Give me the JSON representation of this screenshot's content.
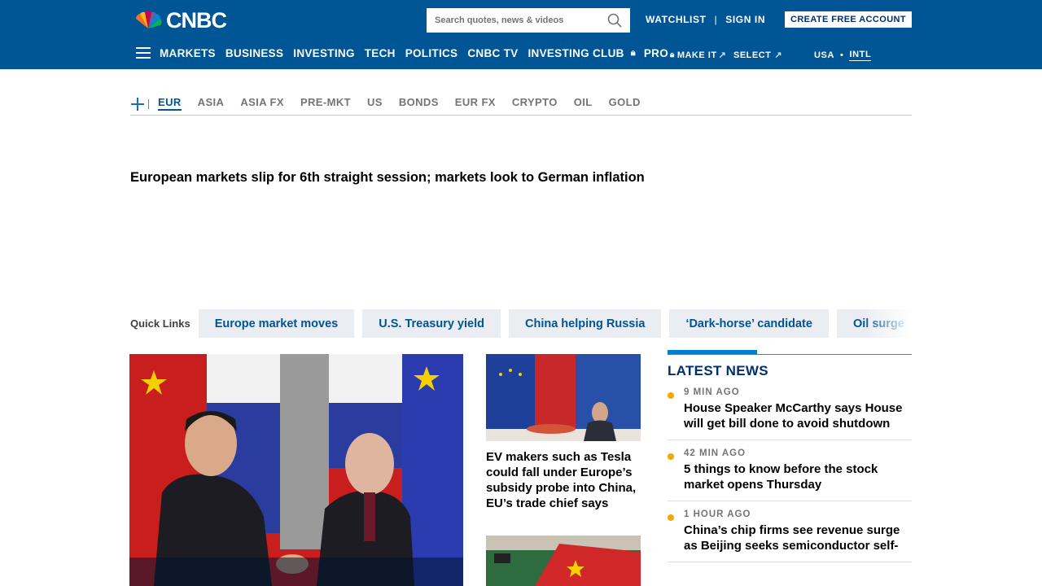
{
  "header": {
    "logo_text": "CNBC",
    "search_placeholder": "Search quotes, news & videos",
    "watchlist": "WATCHLIST",
    "sign_in": "SIGN IN",
    "create_account": "CREATE FREE ACCOUNT"
  },
  "nav": {
    "items": [
      "MARKETS",
      "BUSINESS",
      "INVESTING",
      "TECH",
      "POLITICS",
      "CNBC TV",
      "INVESTING CLUB",
      "PRO"
    ],
    "make_it": "MAKE IT",
    "select": "SELECT",
    "region_usa": "USA",
    "region_intl": "INTL"
  },
  "market_tabs": [
    "EUR",
    "ASIA",
    "ASIA FX",
    "PRE-MKT",
    "US",
    "BONDS",
    "EUR FX",
    "CRYPTO",
    "OIL",
    "GOLD"
  ],
  "headline": "European markets slip for 6th straight session; markets look to German inflation",
  "quick_links": {
    "label": "Quick Links",
    "chips": [
      "Europe market moves",
      "U.S. Treasury yield",
      "China helping Russia",
      "‘Dark-horse’ candidate",
      "Oil surge"
    ]
  },
  "cards": [
    {
      "title": "EV makers such as Tesla could fall under Europe’s subsidy probe into China, EU’s trade chief says"
    }
  ],
  "latest": {
    "title": "LATEST NEWS",
    "items": [
      {
        "time": "9 MIN AGO",
        "title": "House Speaker McCarthy says House will get bill done to avoid shutdown"
      },
      {
        "time": "42 MIN AGO",
        "title": "5 things to know before the stock market opens Thursday"
      },
      {
        "time": "1 HOUR AGO",
        "title": "China’s chip firms see revenue surge as Beijing seeks semiconductor self-"
      }
    ]
  },
  "colors": {
    "brand": "#005594",
    "accent": "#0080d1",
    "dot": "#f5a800"
  }
}
